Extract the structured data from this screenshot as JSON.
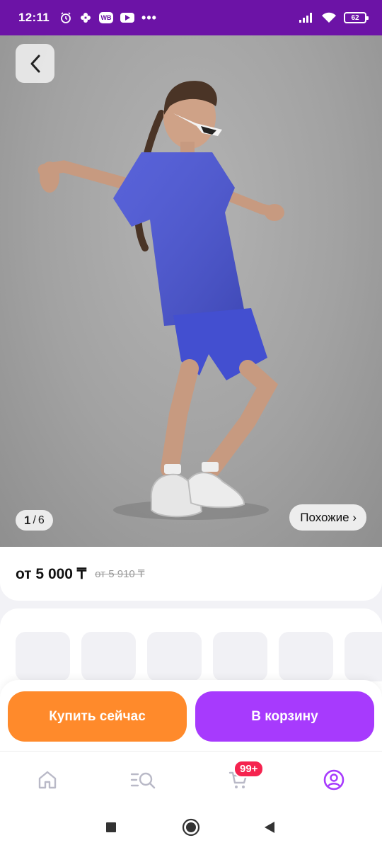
{
  "status_bar": {
    "time": "12:11",
    "wb_label": "WB",
    "more_dots": "•••",
    "battery_level": "62"
  },
  "gallery": {
    "current": "1",
    "separator": "/",
    "total": "6",
    "similar_label": "Похожие ›"
  },
  "price": {
    "current": "от 5 000 ₸",
    "old": "от 5 910 ₸"
  },
  "actions": {
    "buy_now": "Купить сейчас",
    "add_to_cart": "В корзину"
  },
  "bottom_nav": {
    "items": [
      {
        "icon": "home-icon"
      },
      {
        "icon": "catalog-search-icon"
      },
      {
        "icon": "cart-icon"
      },
      {
        "icon": "profile-icon"
      }
    ],
    "cart_badge": "99+"
  },
  "colors": {
    "status_bar": "#6c13a6",
    "buy_button": "#ff8a2b",
    "cart_button": "#a73afd",
    "badge": "#f5234f",
    "active_nav": "#a73afd"
  }
}
